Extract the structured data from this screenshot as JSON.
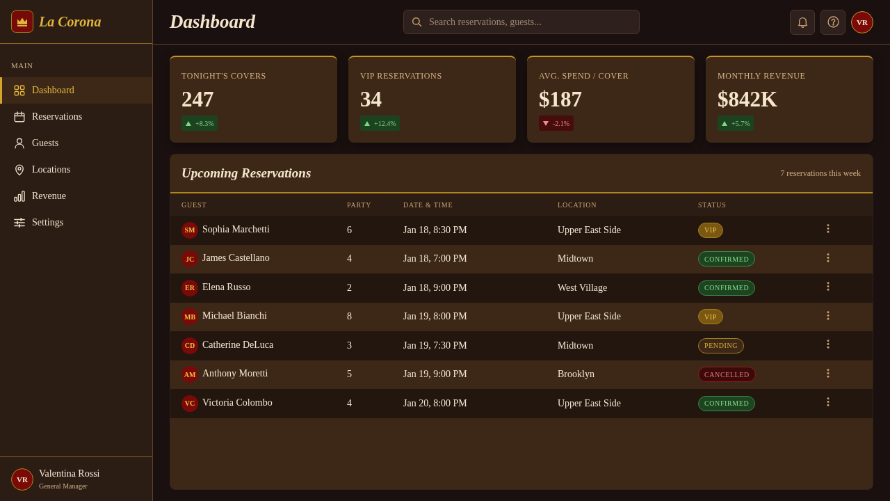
{
  "sidebar": {
    "brand": "La Corona",
    "section_label": "MAIN",
    "items": [
      {
        "label": "Dashboard",
        "selected": true
      },
      {
        "label": "Reservations",
        "selected": false
      },
      {
        "label": "Guests",
        "selected": false
      },
      {
        "label": "Locations",
        "selected": false
      },
      {
        "label": "Revenue",
        "selected": false
      },
      {
        "label": "Settings",
        "selected": false
      }
    ],
    "user": {
      "initials": "VR",
      "name": "Valentina Rossi",
      "role": "General Manager"
    }
  },
  "header": {
    "title": "Dashboard",
    "search": {
      "placeholder": "Search reservations, guests..."
    },
    "avatar_initials": "VR"
  },
  "stats": [
    {
      "label": "TONIGHT'S COVERS",
      "value": "247",
      "change": "+8.3%",
      "rising": true
    },
    {
      "label": "VIP RESERVATIONS",
      "value": "34",
      "change": "+12.4%",
      "rising": true
    },
    {
      "label": "AVG. SPEND / COVER",
      "value": "$187",
      "change": "-2.1%",
      "rising": false
    },
    {
      "label": "MONTHLY REVENUE",
      "value": "$842K",
      "change": "+5.7%",
      "rising": true
    }
  ],
  "reservations": {
    "title": "Upcoming Reservations",
    "summary": "7 reservations this week",
    "columns": [
      "GUEST",
      "PARTY",
      "DATE & TIME",
      "LOCATION",
      "STATUS"
    ],
    "rows": [
      {
        "initials": "SM",
        "guest": "Sophia Marchetti",
        "party": "6",
        "datetime": "Jan 18, 8:30 PM",
        "location": "Upper East Side",
        "status": {
          "label": "VIP",
          "kind": "vip"
        }
      },
      {
        "initials": "JC",
        "guest": "James Castellano",
        "party": "4",
        "datetime": "Jan 18, 7:00 PM",
        "location": "Midtown",
        "status": {
          "label": "CONFIRMED",
          "kind": "confirmed"
        }
      },
      {
        "initials": "ER",
        "guest": "Elena Russo",
        "party": "2",
        "datetime": "Jan 18, 9:00 PM",
        "location": "West Village",
        "status": {
          "label": "CONFIRMED",
          "kind": "confirmed"
        }
      },
      {
        "initials": "MB",
        "guest": "Michael Bianchi",
        "party": "8",
        "datetime": "Jan 19, 8:00 PM",
        "location": "Upper East Side",
        "status": {
          "label": "VIP",
          "kind": "vip"
        }
      },
      {
        "initials": "CD",
        "guest": "Catherine DeLuca",
        "party": "3",
        "datetime": "Jan 19, 7:30 PM",
        "location": "Midtown",
        "status": {
          "label": "PENDING",
          "kind": "pending"
        }
      },
      {
        "initials": "AM",
        "guest": "Anthony Moretti",
        "party": "5",
        "datetime": "Jan 19, 9:00 PM",
        "location": "Brooklyn",
        "status": {
          "label": "CANCELLED",
          "kind": "cancelled"
        }
      },
      {
        "initials": "VC",
        "guest": "Victoria Colombo",
        "party": "4",
        "datetime": "Jan 20, 8:00 PM",
        "location": "Upper East Side",
        "status": {
          "label": "CONFIRMED",
          "kind": "confirmed"
        }
      }
    ]
  }
}
